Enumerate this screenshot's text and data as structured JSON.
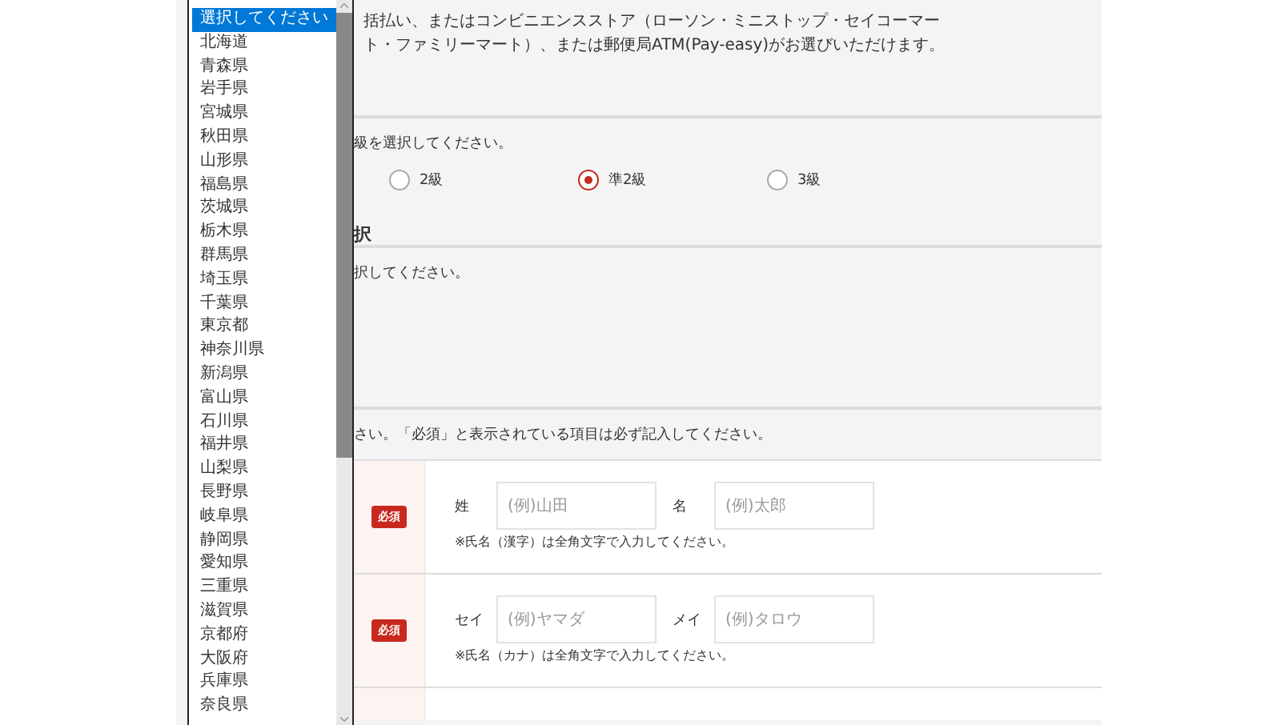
{
  "intro_lines": [
    "括払い、またはコンビニエンスストア（ローソン・ミニストップ・セイコーマー",
    "ト・ファミリーマート）、または郵便局ATM(Pay-easy)がお選びいただけます。"
  ],
  "grade_section": {
    "instruction": "級を選択してください。",
    "options": [
      {
        "label": "2級",
        "selected": false
      },
      {
        "label": "準2級",
        "selected": true
      },
      {
        "label": "3級",
        "selected": false
      }
    ]
  },
  "second_section": {
    "heading": "択",
    "instruction": "択してください。"
  },
  "form_section": {
    "instruction": "さい。「必須」と表示されている項目は必ず記入してください。",
    "rows": [
      {
        "badge": "必須",
        "fields": [
          {
            "label": "姓",
            "placeholder": "(例)山田"
          },
          {
            "label": "名",
            "placeholder": "(例)太郎"
          }
        ],
        "note": "※氏名（漢字）は全角文字で入力してください。"
      },
      {
        "badge": "必須",
        "fields": [
          {
            "label": "セイ",
            "placeholder": "(例)ヤマダ"
          },
          {
            "label": "メイ",
            "placeholder": "(例)タロウ"
          }
        ],
        "note": "※氏名（カナ）は全角文字で入力してください。"
      }
    ]
  },
  "prefecture_dropdown": {
    "options": [
      {
        "label": "選択してください",
        "selected": true
      },
      {
        "label": "北海道",
        "selected": false
      },
      {
        "label": "青森県",
        "selected": false
      },
      {
        "label": "岩手県",
        "selected": false
      },
      {
        "label": "宮城県",
        "selected": false
      },
      {
        "label": "秋田県",
        "selected": false
      },
      {
        "label": "山形県",
        "selected": false
      },
      {
        "label": "福島県",
        "selected": false
      },
      {
        "label": "茨城県",
        "selected": false
      },
      {
        "label": "栃木県",
        "selected": false
      },
      {
        "label": "群馬県",
        "selected": false
      },
      {
        "label": "埼玉県",
        "selected": false
      },
      {
        "label": "千葉県",
        "selected": false
      },
      {
        "label": "東京都",
        "selected": false
      },
      {
        "label": "神奈川県",
        "selected": false
      },
      {
        "label": "新潟県",
        "selected": false
      },
      {
        "label": "富山県",
        "selected": false
      },
      {
        "label": "石川県",
        "selected": false
      },
      {
        "label": "福井県",
        "selected": false
      },
      {
        "label": "山梨県",
        "selected": false
      },
      {
        "label": "長野県",
        "selected": false
      },
      {
        "label": "岐阜県",
        "selected": false
      },
      {
        "label": "静岡県",
        "selected": false
      },
      {
        "label": "愛知県",
        "selected": false
      },
      {
        "label": "三重県",
        "selected": false
      },
      {
        "label": "滋賀県",
        "selected": false
      },
      {
        "label": "京都府",
        "selected": false
      },
      {
        "label": "大阪府",
        "selected": false
      },
      {
        "label": "兵庫県",
        "selected": false
      },
      {
        "label": "奈良県",
        "selected": false
      }
    ]
  }
}
